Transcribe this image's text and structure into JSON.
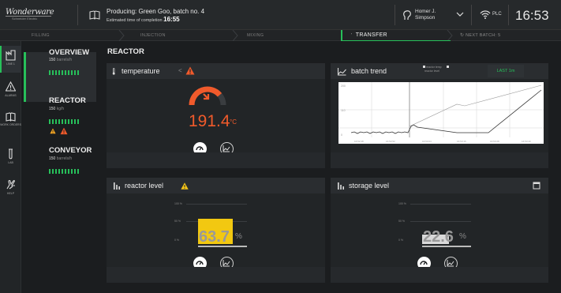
{
  "header": {
    "logo_text": "Wonderware",
    "logo_sub": "Schneider Electric",
    "producing": "Producing: Green Goo, batch no. 4",
    "eta_label": "Estimated time of completion",
    "eta_time": "16:55",
    "user_first": "Homer J.",
    "user_last": "Simpson",
    "plc_label": "PLC",
    "clock": "16:53"
  },
  "steps": {
    "filling": "FILLING",
    "injection": "INJECTION",
    "mixing": "MIXING",
    "transfer": "TRANSFER",
    "next_batch": "NEXT BATCH: 5"
  },
  "sidebar": {
    "items": [
      {
        "label": "LINE 1",
        "icon": "line-icon"
      },
      {
        "label": "ALARMS",
        "icon": "warning-icon"
      },
      {
        "label": "WORK ORDERS",
        "icon": "book-icon"
      },
      {
        "label": "LAB",
        "icon": "testtube-icon"
      },
      {
        "label": "HELP",
        "icon": "hand-icon"
      }
    ]
  },
  "units": [
    {
      "name": "OVERVIEW",
      "rate_value": "150",
      "rate_unit": "barrels/h",
      "bar_count": 10
    },
    {
      "name": "REACTOR",
      "rate_value": "150",
      "rate_unit": "kg/h",
      "bar_count": 10,
      "warnings": 2
    },
    {
      "name": "CONVEYOR",
      "rate_value": "150",
      "rate_unit": "barrels/h",
      "bar_count": 10
    }
  ],
  "main": {
    "title": "REACTOR"
  },
  "temperature": {
    "title": "temperature",
    "value": "191.4",
    "unit": "°C",
    "gauge_fraction": 0.78,
    "color": "#f05a2b"
  },
  "batch_trend": {
    "title": "batch trend",
    "legend": [
      "reactor temp",
      "reactor level"
    ],
    "range_button": "LAST 1m",
    "y_ticks": [
      "200",
      "110",
      "0"
    ],
    "x_ticks": [
      "16:52:48",
      "16:52:52",
      "16:53:04",
      "16:53:16",
      "16:53:28",
      "16:53:40"
    ]
  },
  "reactor_level": {
    "title": "reactor level",
    "value": "63.7",
    "unit": "%",
    "ticks": [
      "100 %",
      "50 %",
      "0 %"
    ],
    "fill_fraction": 0.637,
    "color": "#f2c811"
  },
  "storage_level": {
    "title": "storage level",
    "value": "22.6",
    "unit": "%",
    "ticks": [
      "100 %",
      "50 %",
      "0 %"
    ],
    "fill_fraction": 0.226,
    "color": "#d9d9d9"
  },
  "colors": {
    "accent": "#27c05a",
    "warning": "#f5a623",
    "alarm": "#f05a2b"
  }
}
